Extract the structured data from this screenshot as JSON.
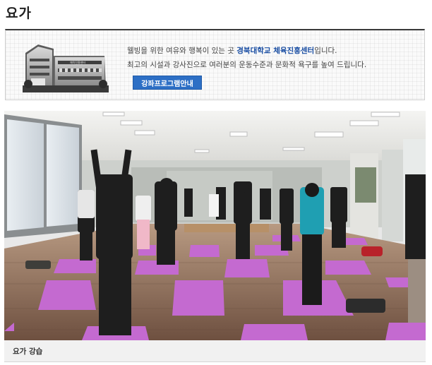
{
  "page": {
    "title": "요가"
  },
  "intro": {
    "line1_prefix": "웰빙을 위한 여유와 행복이 있는 곳 ",
    "line1_highlight": "경북대학교 체육진흥센터",
    "line1_suffix": "입니다.",
    "line2": "최고의 시설과 강사진으로 여러분의 운동수준과 문화적 욕구를 높여 드립니다.",
    "button_label": "강좌프로그램안내",
    "building_sign": "체육진흥센터"
  },
  "photo": {
    "caption": "요가 강습"
  },
  "colors": {
    "accent_blue": "#2d6fc5",
    "highlight_text": "#1a4ea3",
    "mat_purple": "#c46ad0",
    "floor_wood": "#8a6a55"
  }
}
